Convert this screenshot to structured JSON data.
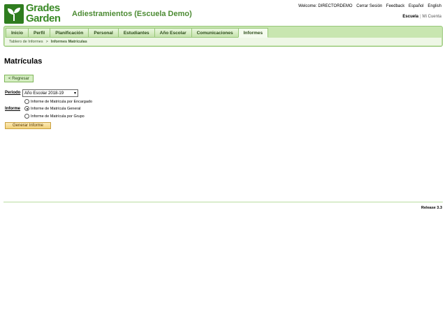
{
  "logo": {
    "line1": "Grades",
    "line2": "Garden"
  },
  "school": {
    "title": "Adiestramientos (Escuela Demo)"
  },
  "top_links": {
    "welcome": "Welcome: DIRECTORDEMO",
    "logout": "Cerrar Sesión",
    "feedback": "Feedback",
    "spanish": "Español",
    "english": "English"
  },
  "switch": {
    "school": "Escuela",
    "separator": "|",
    "account": "Mi Cuenta"
  },
  "nav": {
    "tabs": [
      {
        "label": "Inicio"
      },
      {
        "label": "Perfil"
      },
      {
        "label": "Planificación"
      },
      {
        "label": "Personal"
      },
      {
        "label": "Estudiantes"
      },
      {
        "label": "Año Escolar"
      },
      {
        "label": "Comunicaciones"
      },
      {
        "label": "Informes"
      }
    ],
    "active_tab": "Informes"
  },
  "breadcrumb": {
    "parent": "Tablero de Informes",
    "arrow": ">",
    "current": "Informes Matrículas"
  },
  "page": {
    "title": "Matrículas",
    "back_label": "< Regresar"
  },
  "form": {
    "period_label": "Periodo",
    "period_value": "Año Escolar 2018-19",
    "report_label": "Informe",
    "report_options": [
      {
        "label": "Informe de Matrícula por Encargado",
        "checked": false
      },
      {
        "label": "Informe de Matrícula General",
        "checked": true
      },
      {
        "label": "Informe de Matrícula por Grupo",
        "checked": false
      }
    ],
    "generate_label": "Generar Informe"
  },
  "footer": {
    "release": "Release 3.3"
  },
  "colors": {
    "accent": "#4c8b33",
    "nav_bg": "#c8e6b0",
    "button_orange": "#f3d27a"
  }
}
